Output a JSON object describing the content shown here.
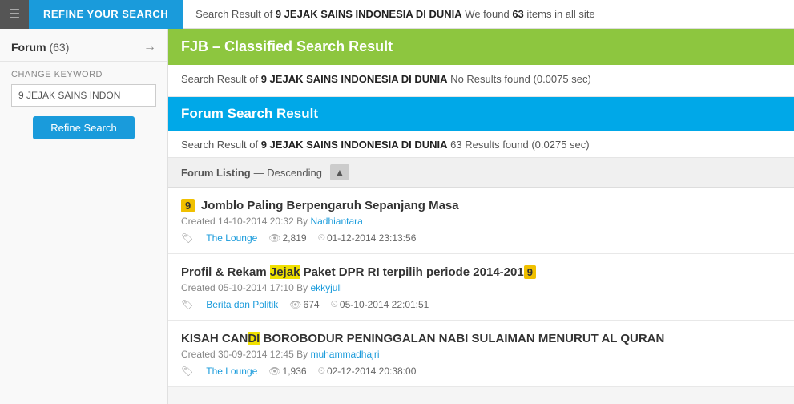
{
  "topbar": {
    "refine_label": "REFINE YOUR SEARCH",
    "search_prefix": "Search Result of ",
    "search_query": "9 JEJAK SAINS INDONESIA DI DUNIA",
    "search_suffix": " We found ",
    "search_count": "63",
    "search_suffix2": " items in all site"
  },
  "sidebar": {
    "forum_label": "Forum",
    "forum_count": "(63)",
    "change_keyword_label": "CHANGE KEYWORD",
    "input_value": "9 JEJAK SAINS INDON",
    "refine_button": "Refine Search"
  },
  "fjb": {
    "header": "FJB – Classified Search Result",
    "search_prefix": "Search Result of ",
    "search_query": "9 JEJAK SAINS INDONESIA DI DUNIA",
    "search_suffix": "  No Results found (0.0075 sec)"
  },
  "forum_search": {
    "header": "Forum Search Result",
    "search_prefix": "Search Result of ",
    "search_query": "9 JEJAK SAINS INDONESIA DI DUNIA",
    "search_suffix": " 63 Results found (0.0275 sec)"
  },
  "listing": {
    "label": "Forum Listing",
    "sort_label": "— Descending"
  },
  "results": [
    {
      "number": "9",
      "title_before": "Jomblo Paling Berpengaruh Sepanjang Masa",
      "title_highlight": "",
      "title_after": "",
      "created": "Created 14-10-2014 20:32 By ",
      "author": "Nadhiantara",
      "tag": "The Lounge",
      "views": "2,819",
      "last_post": "01-12-2014 23:13:56"
    },
    {
      "number": "",
      "title_before": "Profil & Rekam ",
      "title_highlight": "Jejak",
      "title_after": " Paket DPR RI terpilih periode 2014-201",
      "number_suffix": "9",
      "created": "Created 05-10-2014 17:10 By ",
      "author": "ekkyjull",
      "tag": "Berita dan Politik",
      "views": "674",
      "last_post": "05-10-2014 22:01:51"
    },
    {
      "number": "",
      "title_before": "KISAH CAN",
      "title_highlight": "DI",
      "title_after": " BOROBODUR PENINGGALAN NABI SULAIMAN MENURUT AL QURAN",
      "created": "Created 30-09-2014 12:45 By ",
      "author": "muhammadhajri",
      "tag": "The Lounge",
      "views": "1,936",
      "last_post": "02-12-2014 20:38:00"
    }
  ]
}
